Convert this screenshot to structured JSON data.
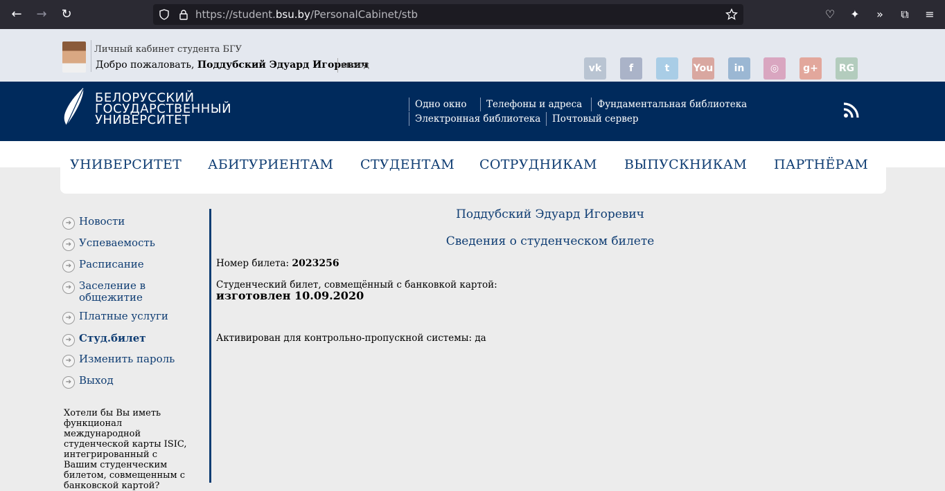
{
  "browser": {
    "url_prefix": "https://student.",
    "url_host": "bsu.by",
    "url_path": "/PersonalCabinet/stb"
  },
  "top": {
    "cabinet_title": "Личный кабинет студента БГУ",
    "welcome_prefix": "Добро пожаловать,",
    "user_name": "Поддубский Эдуард Игоревич",
    "logout": "выход"
  },
  "social": [
    {
      "name": "vk-icon",
      "glyph": "vk",
      "color": "#b9c4d2"
    },
    {
      "name": "facebook-icon",
      "glyph": "f",
      "color": "#aab3c8"
    },
    {
      "name": "twitter-icon",
      "glyph": "t",
      "color": "#a9cde6"
    },
    {
      "name": "youtube-icon",
      "glyph": "You",
      "color": "#d9a7a0"
    },
    {
      "name": "linkedin-icon",
      "glyph": "in",
      "color": "#9bb7d3"
    },
    {
      "name": "instagram-icon",
      "glyph": "◎",
      "color": "#d9a6c0"
    },
    {
      "name": "google-plus-icon",
      "glyph": "g+",
      "color": "#e2a79c"
    },
    {
      "name": "researchgate-icon",
      "glyph": "RG",
      "color": "#b3ccbd"
    }
  ],
  "header": {
    "logo_line1": "БЕЛОРУССКИЙ",
    "logo_line2": "ГОСУДАРСТВЕННЫЙ",
    "logo_line3": "УНИВЕРСИТЕТ",
    "links": {
      "one_window": "Одно окно",
      "phones": "Телефоны и адреса",
      "fundamental_library": "Фундаментальная библиотека",
      "electronic_library": "Электронная библиотека",
      "mail_server": "Почтовый сервер"
    }
  },
  "mainnav": {
    "university": "УНИВЕРСИТЕТ",
    "applicants": "АБИТУРИЕНТАМ",
    "students": "СТУДЕНТАМ",
    "staff": "СОТРУДНИКАМ",
    "graduates": "ВЫПУСКНИКАМ",
    "partners": "ПАРТНЁРАМ"
  },
  "sidebar": {
    "items": [
      {
        "label": "Новости"
      },
      {
        "label": "Успеваемость"
      },
      {
        "label": "Расписание"
      },
      {
        "label_line1": "Заселение в",
        "label_line2": "общежитие"
      },
      {
        "label": "Платные услуги"
      },
      {
        "label": "Студ.билет"
      },
      {
        "label": "Изменить пароль"
      },
      {
        "label": "Выход"
      }
    ],
    "promo_text": "Хотели бы Вы иметь функционал международной студенческой карты ISIC, интегрированный с Вашим студенческим билетом, совмещенным с банковской картой?"
  },
  "content": {
    "student_name": "Поддубский Эдуард Игоревич",
    "section_title": "Сведения о студенческом билете",
    "ticket_label": "Номер билета:",
    "ticket_number": "2023256",
    "card_label": "Студенческий билет, совмещённый с банковкой картой:",
    "card_status": "изготовлен 10.09.2020",
    "access_label": "Активирован для контрольно-пропускной системы:",
    "access_value": "да"
  }
}
